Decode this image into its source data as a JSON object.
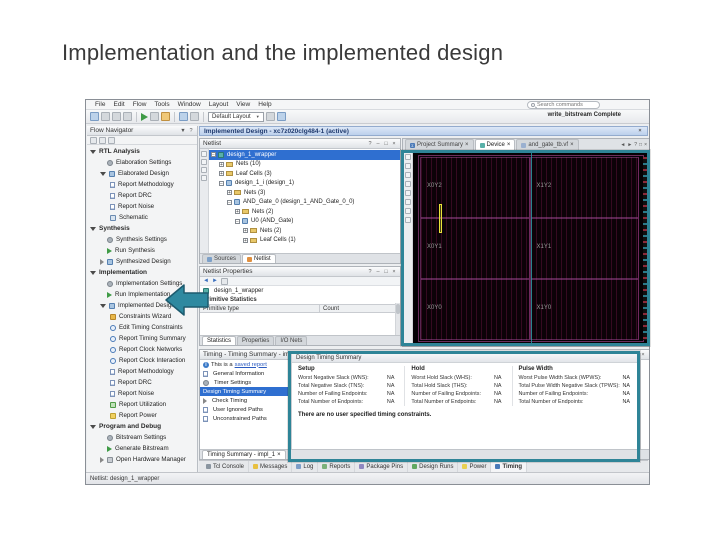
{
  "slide": {
    "title": "Implementation and the implemented design"
  },
  "colors": {
    "annotation_teal": "#2e8497",
    "selection_blue": "#2f6fd0",
    "banner_text": "#1f3a6e",
    "device_background": "#000000",
    "device_region_outline": "#b553a8"
  },
  "icons": {
    "help": "?",
    "min": "–",
    "max": "□",
    "close": "×",
    "caret": "▼",
    "plus": "+",
    "minus": "−",
    "sigma": "Σ",
    "back": "◄",
    "forward": "►",
    "info": "i"
  },
  "window": {
    "menu": [
      "File",
      "Edit",
      "Flow",
      "Tools",
      "Window",
      "Layout",
      "View",
      "Help"
    ],
    "toolbar": {
      "layout": "Default Layout",
      "search_placeholder": "Search commands",
      "status": "write_bitstream Complete"
    },
    "flow": {
      "title": "Flow Navigator",
      "items": [
        {
          "label": "RTL Analysis"
        },
        {
          "label": "Elaboration Settings"
        },
        {
          "label": "Elaborated Design"
        },
        {
          "label": "Report Methodology"
        },
        {
          "label": "Report DRC"
        },
        {
          "label": "Report Noise"
        },
        {
          "label": "Schematic"
        },
        {
          "label": "Synthesis"
        },
        {
          "label": "Synthesis Settings"
        },
        {
          "label": "Run Synthesis"
        },
        {
          "label": "Synthesized Design"
        },
        {
          "label": "Implementation"
        },
        {
          "label": "Implementation Settings"
        },
        {
          "label": "Run Implementation"
        },
        {
          "label": "Implemented Design"
        },
        {
          "label": "Constraints Wizard"
        },
        {
          "label": "Edit Timing Constraints"
        },
        {
          "label": "Report Timing Summary"
        },
        {
          "label": "Report Clock Networks"
        },
        {
          "label": "Report Clock Interaction"
        },
        {
          "label": "Report Methodology"
        },
        {
          "label": "Report DRC"
        },
        {
          "label": "Report Noise"
        },
        {
          "label": "Report Utilization"
        },
        {
          "label": "Report Power"
        },
        {
          "label": "Program and Debug"
        },
        {
          "label": "Bitstream Settings"
        },
        {
          "label": "Generate Bitstream"
        },
        {
          "label": "Open Hardware Manager"
        }
      ]
    },
    "banner": "Implemented Design - xc7z020clg484-1 (active)",
    "netlist": {
      "title": "Netlist",
      "rows": [
        {
          "label": "design_1_wrapper"
        },
        {
          "label": "Nets (10)"
        },
        {
          "label": "Leaf Cells (3)"
        },
        {
          "label": "design_1_i (design_1)"
        },
        {
          "label": "Nets (3)"
        },
        {
          "label": "AND_Gate_0 (design_1_AND_Gate_0_0)"
        },
        {
          "label": "Nets (2)"
        },
        {
          "label": "U0 (AND_Gate)"
        },
        {
          "label": "Nets (2)"
        },
        {
          "label": "Leaf Cells (1)"
        }
      ],
      "tabs": [
        "Sources",
        "Netlist"
      ]
    },
    "props": {
      "title": "Netlist Properties",
      "object": "design_1_wrapper",
      "section": "Primitive Statistics",
      "columns": [
        "Primitive type",
        "Count"
      ],
      "tabs": [
        "Statistics",
        "Properties",
        "I/O Nets"
      ]
    },
    "device": {
      "tabs": [
        "Project Summary",
        "Device",
        "and_gate_tb.vf"
      ],
      "regions": [
        "X0Y2",
        "X1Y2",
        "X0Y1",
        "X1Y1",
        "X0Y0",
        "X1Y0"
      ]
    },
    "timing": {
      "title": "Timing - Timing Summary - impl_1",
      "saved_prefix": "This is a ",
      "saved_link": "saved report",
      "tree": [
        "General Information",
        "Timer Settings",
        "Design Timing Summary",
        "Check Timing",
        "User Ignored Paths",
        "Unconstrained Paths"
      ],
      "report": {
        "title": "Design Timing Summary",
        "columns": [
          {
            "name": "Setup",
            "rows": [
              {
                "label": "Worst Negative Slack (WNS):",
                "value": "NA"
              },
              {
                "label": "Total Negative Slack (TNS):",
                "value": "NA"
              },
              {
                "label": "Number of Failing Endpoints:",
                "value": "NA"
              },
              {
                "label": "Total Number of Endpoints:",
                "value": "NA"
              }
            ]
          },
          {
            "name": "Hold",
            "rows": [
              {
                "label": "Worst Hold Slack (WHS):",
                "value": "NA"
              },
              {
                "label": "Total Hold Slack (THS):",
                "value": "NA"
              },
              {
                "label": "Number of Failing Endpoints:",
                "value": "NA"
              },
              {
                "label": "Total Number of Endpoints:",
                "value": "NA"
              }
            ]
          },
          {
            "name": "Pulse Width",
            "rows": [
              {
                "label": "Worst Pulse Width Slack (WPWS):",
                "value": "NA"
              },
              {
                "label": "Total Pulse Width Negative Slack (TPWS):",
                "value": "NA"
              },
              {
                "label": "Number of Failing Endpoints:",
                "value": "NA"
              },
              {
                "label": "Total Number of Endpoints:",
                "value": "NA"
              }
            ]
          }
        ],
        "note": "There are no user specified timing constraints."
      },
      "tab": "Timing Summary - impl_1"
    },
    "bottom_tabs": [
      "Tcl Console",
      "Messages",
      "Log",
      "Reports",
      "Package Pins",
      "Design Runs",
      "Power",
      "Timing"
    ],
    "status": "Netlist: design_1_wrapper"
  }
}
